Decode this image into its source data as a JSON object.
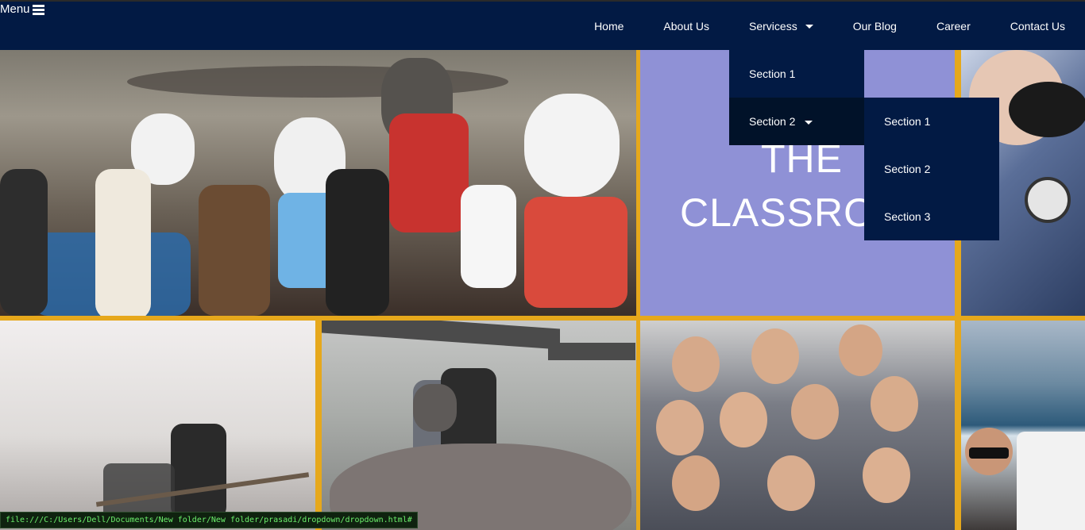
{
  "menu": {
    "label": "Menu",
    "icon": "hamburger-icon"
  },
  "nav": {
    "items": [
      {
        "label": "Home"
      },
      {
        "label": "About Us"
      },
      {
        "label": "Servicess",
        "icon": "caret-down-icon"
      },
      {
        "label": "Our Blog"
      },
      {
        "label": "Career"
      },
      {
        "label": "Contact Us"
      }
    ]
  },
  "dropdown": {
    "level1": [
      {
        "label": "Section 1"
      },
      {
        "label": "Section 2",
        "icon": "caret-down-icon"
      }
    ],
    "level2": [
      {
        "label": "Section 1"
      },
      {
        "label": "Section 2"
      },
      {
        "label": "Section 3"
      }
    ]
  },
  "tiles": {
    "classroom_line1": "THE",
    "classroom_line2": "CLASSRO"
  },
  "status_bar": {
    "text": "file:///C:/Users/Dell/Documents/New folder/New folder/prasadi/dropdown/dropdown.html#"
  },
  "colors": {
    "nav_bg": "#021a44",
    "gutter": "#e6a81c",
    "tile_purple": "#8f91d6",
    "status_text": "#6cf06c"
  }
}
